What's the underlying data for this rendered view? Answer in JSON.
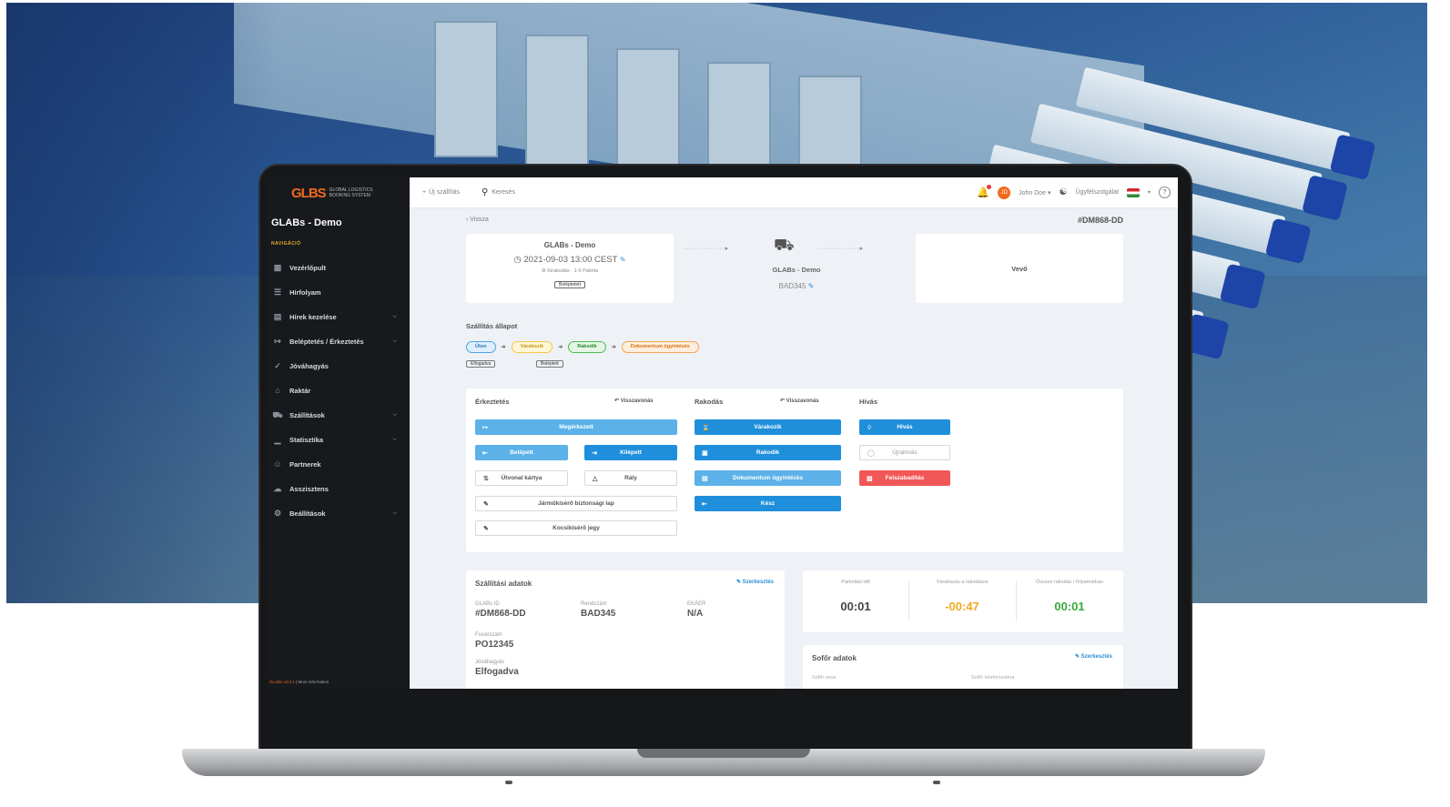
{
  "sidebar": {
    "logo_mark": "GLBS",
    "logo_text": "GLOBAL LOGISTICS BOOKING SYSTEM",
    "company": "GLABs - Demo",
    "nav_caption": "NAVIGÁCIÓ",
    "items": [
      {
        "label": "Vezérlőpult",
        "icon": "dashboard-icon",
        "chevron": false
      },
      {
        "label": "Hírfolyam",
        "icon": "news-icon",
        "chevron": false
      },
      {
        "label": "Hírek kezelése",
        "icon": "news-manage-icon",
        "chevron": true
      },
      {
        "label": "Beléptetés / Érkeztetés",
        "icon": "checkin-icon",
        "chevron": true
      },
      {
        "label": "Jóváhagyás",
        "icon": "approval-icon",
        "chevron": false
      },
      {
        "label": "Raktár",
        "icon": "warehouse-icon",
        "chevron": false
      },
      {
        "label": "Szállítások",
        "icon": "truck-icon",
        "chevron": true
      },
      {
        "label": "Statisztika",
        "icon": "chart-icon",
        "chevron": true
      },
      {
        "label": "Partnerek",
        "icon": "partners-icon",
        "chevron": false
      },
      {
        "label": "Asszisztens",
        "icon": "assistant-icon",
        "chevron": false
      },
      {
        "label": "Beállítások",
        "icon": "settings-icon",
        "chevron": true
      }
    ],
    "footer_version": "GLABs v2.0.1",
    "footer_link": "| More information"
  },
  "topbar": {
    "new_shipment": "Új szállítás",
    "search": "Keresés",
    "user": "John Doe",
    "support": "Ügyfélszolgálat",
    "avatar_initials": "JD"
  },
  "main": {
    "back": "Vissza",
    "shipment_id": "#DM868-DD",
    "route_from": {
      "title": "GLABs - Demo",
      "datetime": "2021-09-03 13:00 CEST",
      "sub": "Kirakodás · 1-5 Paletta",
      "pill": "Beléptetett"
    },
    "route_mid": {
      "carrier": "GLABs - Demo",
      "plate": "BAD345"
    },
    "route_to": {
      "label": "Vevő"
    },
    "status_title": "Szállítás állapot",
    "status_chips": [
      "Úton",
      "Várakozik",
      "Rakodik",
      "Dokumentum ügyintézés"
    ],
    "status_sub": [
      "Elfogadva",
      "Beléptett"
    ],
    "actions": {
      "arrival_title": "Érkeztetés",
      "arrival_undo": "Visszavonás",
      "arrived": "Megérkezett",
      "checked_in": "Belépett",
      "checked_out": "Kilépett",
      "route_card": "Útvonal kártya",
      "ramp": "Rály",
      "safety_sheet": "Járműkísérő biztonsági lap",
      "waybill": "Kocsikísérő jegy",
      "loading_title": "Rakodás",
      "loading_undo": "Visszavonás",
      "waiting": "Várakozik",
      "loading": "Rakodik",
      "documents": "Dokumentum ügyintézés",
      "ready": "Kész",
      "call_title": "Hívás",
      "call": "Hívás",
      "recall": "Újrahívás",
      "cancel_call": "Felszabadítás"
    },
    "shipping_data": {
      "title": "Szállítási adatok",
      "edit": "Szerkesztés",
      "glabs_id_label": "GLABs ID",
      "glabs_id": "#DM868-DD",
      "plate_label": "Rendszám",
      "plate": "BAD345",
      "ekaer_label": "EKÁER",
      "ekaer": "N/A",
      "order_label": "Fuvarszám",
      "order": "PO12345",
      "approval_label": "Jóváhagyás",
      "approval": "Elfogadva"
    },
    "times": [
      {
        "label": "Parkolási idő",
        "value": "00:01",
        "color": "#444444"
      },
      {
        "label": "Várakozás a rakodásra",
        "value": "-00:47",
        "color": "#f2a81d"
      },
      {
        "label": "Összes rakodás / folyamatban",
        "value": "00:01",
        "color": "#35a93a"
      }
    ],
    "driver": {
      "title": "Sofőr adatok",
      "edit": "Szerkesztés",
      "name_label": "Sofőr neve",
      "phone_label": "Sofőr telefonszáma"
    }
  }
}
